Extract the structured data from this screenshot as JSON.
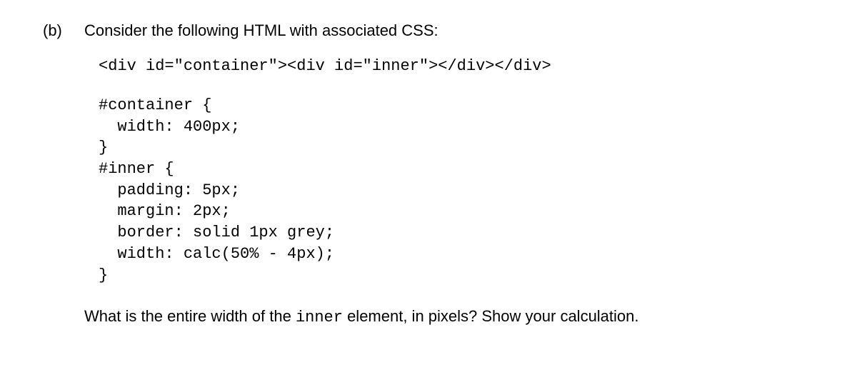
{
  "label": "(b)",
  "intro": "Consider the following HTML with associated CSS:",
  "html_code": "<div id=\"container\"><div id=\"inner\"></div></div>",
  "css_code": "#container {\n  width: 400px;\n}\n#inner {\n  padding: 5px;\n  margin: 2px;\n  border: solid 1px grey;\n  width: calc(50% - 4px);\n}",
  "question_parts": {
    "p1": "What is the entire width of the ",
    "inner_word": "inner",
    "p2": " element, in pixels? Show your calculation."
  }
}
